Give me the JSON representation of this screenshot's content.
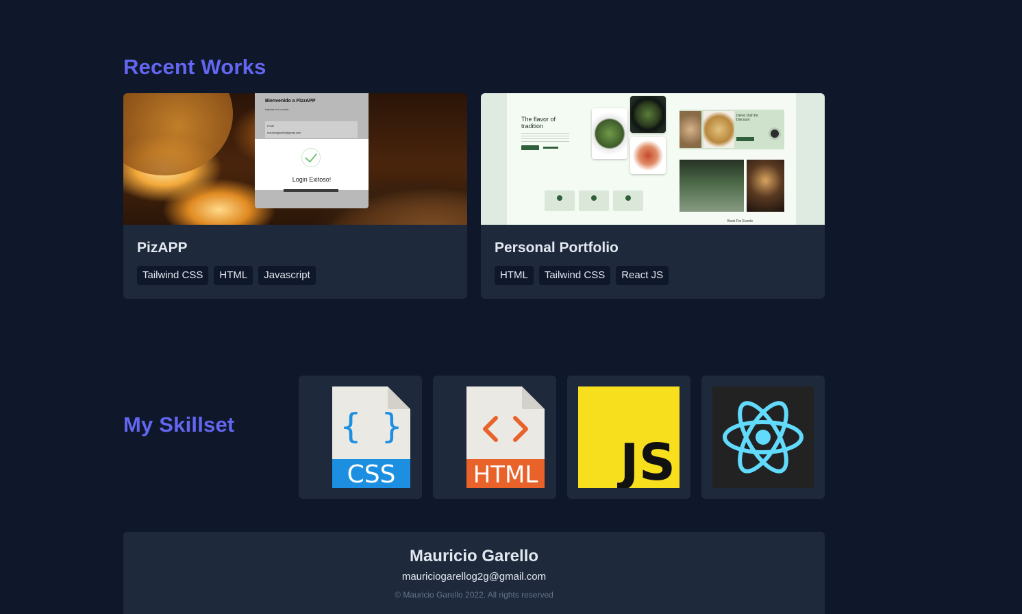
{
  "works": {
    "title": "Recent Works",
    "projects": [
      {
        "name": "PizAPP",
        "tags": [
          "Tailwind CSS",
          "HTML",
          "Javascript"
        ],
        "preview": {
          "heading": "Bienvenido a PizzAPP",
          "subheading": "Ingresa a tu cuenta",
          "field_label": "Email",
          "field_value": "mauriciogarello@gmail.com",
          "modal_text": "Login Exitoso!"
        }
      },
      {
        "name": "Personal Portfolio",
        "tags": [
          "HTML",
          "Tailwind CSS",
          "React JS"
        ],
        "preview": {
          "hero_title": "The flavor of tradition",
          "promo_text": "Demo Dish for Discount",
          "book_text": "Book For Events"
        }
      }
    ]
  },
  "skills": {
    "title": "My Skillset",
    "items": [
      {
        "name": "css-icon",
        "label": "CSS",
        "color": "#1d8fe1"
      },
      {
        "name": "html-icon",
        "label": "HTML",
        "color": "#e8622a"
      },
      {
        "name": "js-icon",
        "label": "JS",
        "color": "#f7df1e"
      },
      {
        "name": "react-icon",
        "label": "",
        "color": "#61dafb"
      }
    ]
  },
  "footer": {
    "name": "Mauricio Garello",
    "email": "mauriciogarellog2g@gmail.com",
    "copyright": "© Mauricio Garello 2022. All rights reserved"
  },
  "colors": {
    "background": "#0f172a",
    "card": "#1e293b",
    "accent": "#6366f1",
    "text": "#e2e8f0",
    "muted": "#64748b"
  }
}
